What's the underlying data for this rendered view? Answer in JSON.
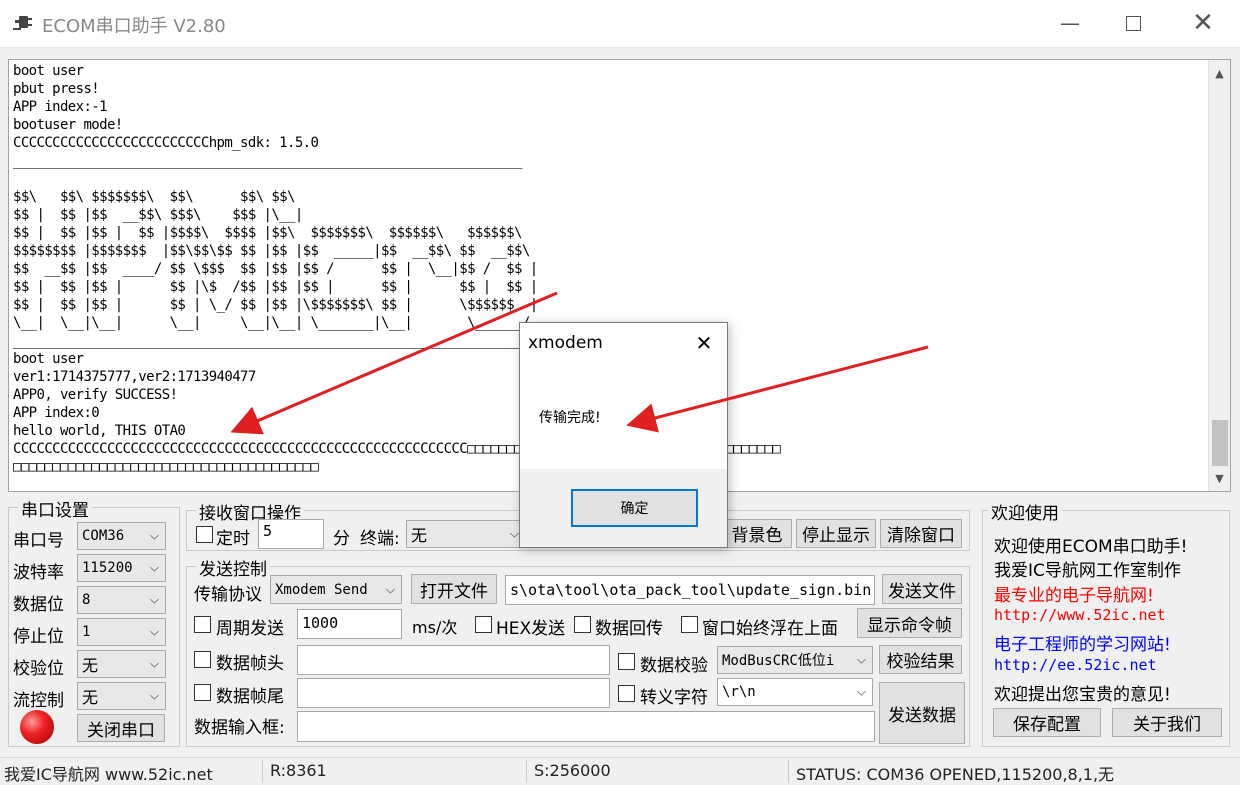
{
  "window": {
    "title": "ECOM串口助手   V2.80",
    "min_icon": "minimize-icon",
    "max_icon": "maximize-icon",
    "close_icon": "close-icon"
  },
  "terminal": {
    "lines": [
      "boot user",
      "pbut press!",
      "APP index:-1",
      "bootuser mode!",
      "CCCCCCCCCCCCCCCCCCCCCCCCChpm_sdk: 1.5.0",
      "_________________________________________________________________",
      "",
      "$$\\   $$\\ $$$$$$$\\  $$\\      $$\\ $$\\",
      "$$ |  $$ |$$  __$$\\ $$$\\    $$$ |\\__|",
      "$$ |  $$ |$$ |  $$ |$$$$\\  $$$$ |$$\\  $$$$$$$\\  $$$$$$\\   $$$$$$\\",
      "$$$$$$$$ |$$$$$$$  |$$\\$$\\$$ $$ |$$ |$$  _____|$$  __$$\\ $$  __$$\\",
      "$$  __$$ |$$  ____/ $$ \\$$$  $$ |$$ |$$ /      $$ |  \\__|$$ /  $$ |",
      "$$ |  $$ |$$ |      $$ |\\$  /$$ |$$ |$$ |      $$ |      $$ |  $$ |",
      "$$ |  $$ |$$ |      $$ | \\_/ $$ |$$ |\\$$$$$$$\\ $$ |      \\$$$$$$  |",
      "\\__|  \\__|\\__|      \\__|     \\__|\\__| \\_______|\\__|       \\______/",
      "_________________________________________________________________",
      "boot user",
      "ver1:1714375777,ver2:1713940477",
      "APP0, verify SUCCESS!",
      "APP index:0",
      "hello world, THIS OTA0",
      "CCCCCCCCCCCCCCCCCCCCCCCCCCCCCCCCCCCCCCCCCCCCCCCCCCCCCCCCCC□□□□□□□□□□□□□□□□□□□□□□□□□□□□□□□□□□□□□□□□",
      "□□□□□□□□□□□□□□□□□□□□□□□□□□□□□□□□□□□□□□□"
    ]
  },
  "serial": {
    "legend": "串口设置",
    "port_label": "串口号",
    "port_value": "COM36",
    "baud_label": "波特率",
    "baud_value": "115200",
    "databits_label": "数据位",
    "databits_value": "8",
    "stopbits_label": "停止位",
    "stopbits_value": "1",
    "parity_label": "校验位",
    "parity_value": "无",
    "flow_label": "流控制",
    "flow_value": "无",
    "close_button": "关闭串口",
    "led_color": "#ee2222"
  },
  "receive": {
    "legend": "接收窗口操作",
    "timer_label": "定时",
    "timer_value": "5",
    "unit_minute": "分",
    "terminal_label": "终端:",
    "terminal_value": "无",
    "bg_button": "背景色",
    "stop_button": "停止显示",
    "clear_button": "清除窗口"
  },
  "send": {
    "legend": "发送控制",
    "protocol_label": "传输协议",
    "protocol_value": "Xmodem Send",
    "open_file_button": "打开文件",
    "file_path": "s\\ota\\tool\\ota_pack_tool\\update_sign.bin",
    "send_file_button": "发送文件",
    "periodic_label": "周期发送",
    "period_value": "1000",
    "period_unit": "ms/次",
    "hex_label": "HEX发送",
    "echo_label": "数据回传",
    "ontop_label": "窗口始终浮在上面",
    "show_cmd_button": "显示命令帧",
    "header_label": "数据帧头",
    "checksum_label": "数据校验",
    "checksum_value": "ModBusCRC低位i",
    "check_result_button": "校验结果",
    "tail_label": "数据帧尾",
    "escape_label": "转义字符",
    "escape_value": "\\r\\n",
    "input_label": "数据输入框:",
    "send_data_button": "发送数据"
  },
  "welcome": {
    "legend": "欢迎使用",
    "line1": "欢迎使用ECOM串口助手!",
    "line2": "我爱IC导航网工作室制作",
    "line3": "最专业的电子导航网!",
    "url1": "http://www.52ic.net",
    "line4": "电子工程师的学习网站!",
    "url2": "http://ee.52ic.net",
    "line5": "欢迎提出您宝贵的意见!",
    "save_button": "保存配置",
    "about_button": "关于我们"
  },
  "status": {
    "site": "我爱IC导航网 www.52ic.net",
    "received": "R:8361",
    "sent": "S:256000",
    "state": "STATUS:  COM36 OPENED,115200,8,1,无"
  },
  "dialog": {
    "title": "xmodem",
    "message": "传输完成!",
    "ok_button": "确定"
  },
  "colors": {
    "accent": "#0078d7",
    "arrow": "#e02020",
    "link": "#0000ff",
    "highlight": "#ff0000"
  }
}
